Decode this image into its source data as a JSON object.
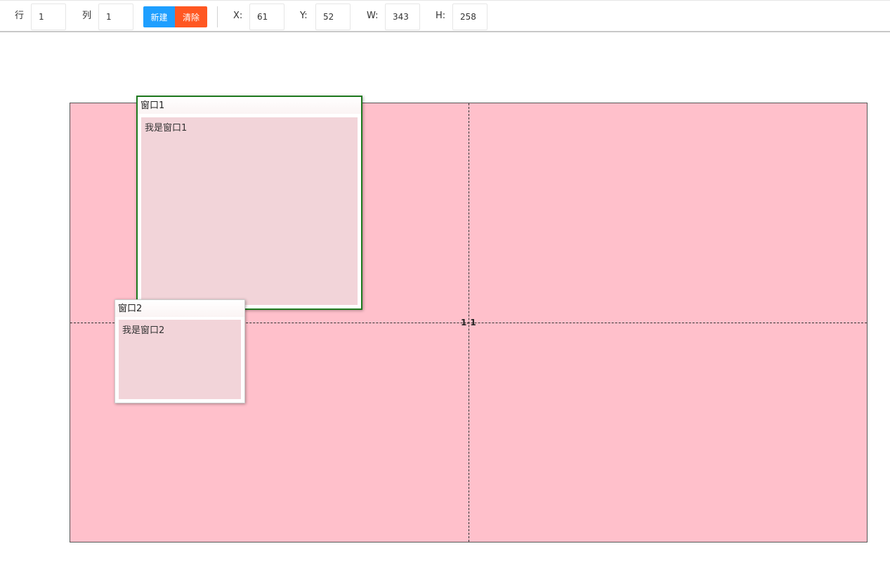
{
  "toolbar": {
    "row_label": "行",
    "row_value": "1",
    "col_label": "列",
    "col_value": "1",
    "new_button": "新建",
    "clear_button": "清除",
    "x_label": "X:",
    "x_value": "61",
    "y_label": "Y:",
    "y_value": "52",
    "w_label": "W:",
    "w_value": "343",
    "h_label": "H:",
    "h_value": "258"
  },
  "grid": {
    "cell_label": "1-1"
  },
  "windows": [
    {
      "title": "窗口1",
      "content": "我是窗口1",
      "selected": true
    },
    {
      "title": "窗口2",
      "content": "我是窗口2",
      "selected": false
    }
  ],
  "colors": {
    "canvas_bg": "#ffc0cb",
    "window_body_bg": "#f2d4d9",
    "selected_border": "#1f7a1f",
    "new_button_bg": "#1e9fff",
    "clear_button_bg": "#ff5722"
  }
}
